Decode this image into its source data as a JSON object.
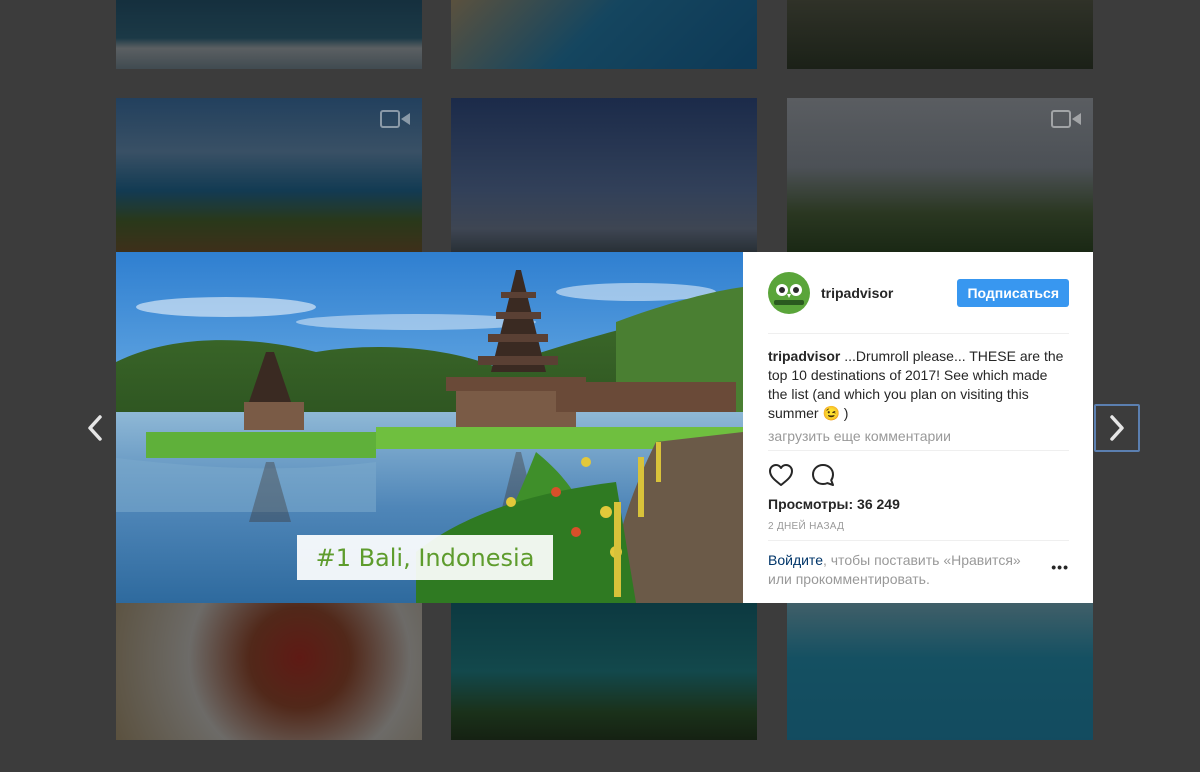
{
  "modal": {
    "media": {
      "overlay_caption": "#1 Bali, Indonesia"
    },
    "post": {
      "username": "tripadvisor",
      "avatar_logo": "tripadvisor",
      "follow_label": "Подписаться",
      "caption_user": "tripadvisor",
      "caption_text": " ...Drumroll please... THESE are the top 10 destinations of 2017! See which made the list (and which you plan on visiting this summer 😉 )",
      "load_more_comments": "загрузить еще комментарии",
      "views": "Просмотры: 36 249",
      "timestamp": "2 ДНЕЙ НАЗАД",
      "login_link": "Войдите",
      "login_rest": ", чтобы поставить «Нравится» или прокомментировать.",
      "more_options": "•••"
    }
  },
  "icons": {
    "like": "heart-icon",
    "comment": "comment-icon",
    "prev": "chevron-left-icon",
    "next": "chevron-right-icon",
    "video": "video-camera-icon"
  },
  "colors": {
    "follow_button": "#3897f0",
    "login_link": "#003569",
    "avatar_bg": "#5aa53a",
    "caption_text_green": "#5e9c2d"
  }
}
